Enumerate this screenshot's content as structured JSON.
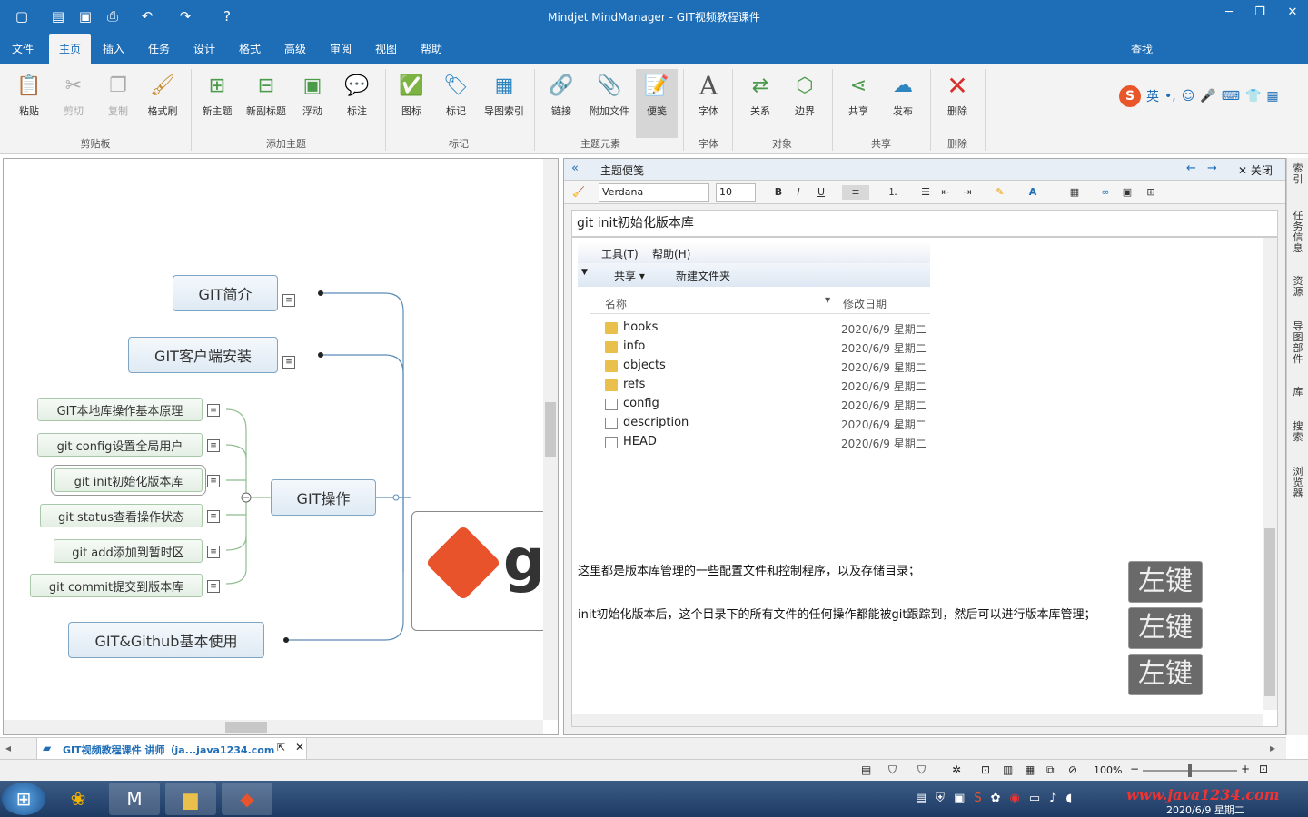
{
  "window": {
    "title": "Mindjet MindManager - GIT视频教程课件",
    "minimize": "─",
    "restore": "❐",
    "close": "✕"
  },
  "quick_access": [
    "new-icon",
    "open-icon",
    "save-icon",
    "print-icon",
    "undo-icon",
    "redo-icon",
    "help-icon"
  ],
  "menu": {
    "tabs": [
      "文件",
      "主页",
      "插入",
      "任务",
      "设计",
      "格式",
      "高级",
      "审阅",
      "视图",
      "帮助"
    ],
    "active": "主页",
    "find": "查找"
  },
  "ribbon": {
    "buttons": [
      {
        "label": "粘贴",
        "icon": "paste-icon",
        "disabled": false
      },
      {
        "label": "剪切",
        "icon": "scissors-icon",
        "disabled": true
      },
      {
        "label": "复制",
        "icon": "copy-icon",
        "disabled": true
      },
      {
        "label": "格式刷",
        "icon": "brush-icon",
        "disabled": false
      },
      {
        "label": "新主题",
        "icon": "new-topic-icon",
        "disabled": false
      },
      {
        "label": "新副标题",
        "icon": "new-subtopic-icon",
        "disabled": false
      },
      {
        "label": "浮动",
        "icon": "floating-icon",
        "disabled": false
      },
      {
        "label": "标注",
        "icon": "callout-icon",
        "disabled": false
      },
      {
        "label": "图标",
        "icon": "icon-marker-icon",
        "disabled": false
      },
      {
        "label": "标记",
        "icon": "tag-icon",
        "disabled": false
      },
      {
        "label": "导图索引",
        "icon": "map-index-icon",
        "disabled": false
      },
      {
        "label": "链接",
        "icon": "link-icon",
        "disabled": false
      },
      {
        "label": "附加文件",
        "icon": "attach-icon",
        "disabled": false
      },
      {
        "label": "便笺",
        "icon": "note-icon",
        "disabled": false
      },
      {
        "label": "字体",
        "icon": "font-icon",
        "disabled": false
      },
      {
        "label": "关系",
        "icon": "relationship-icon",
        "disabled": false
      },
      {
        "label": "边界",
        "icon": "boundary-icon",
        "disabled": false
      },
      {
        "label": "共享",
        "icon": "share-icon",
        "disabled": false
      },
      {
        "label": "发布",
        "icon": "publish-icon",
        "disabled": false
      },
      {
        "label": "删除",
        "icon": "delete-icon",
        "disabled": false
      }
    ],
    "groups": [
      "剪贴板",
      "添加主题",
      "标记",
      "主题元素",
      "字体",
      "对象",
      "共享",
      "删除"
    ],
    "ime": {
      "lang": "英"
    }
  },
  "mindmap": {
    "topics": [
      {
        "label": "GIT简介"
      },
      {
        "label": "GIT客户端安装"
      },
      {
        "label": "GIT操作"
      },
      {
        "label": "GIT&Github基本使用"
      }
    ],
    "subtopics": [
      {
        "label": "GIT本地库操作基本原理"
      },
      {
        "label": "git config设置全局用户"
      },
      {
        "label": "git init初始化版本库"
      },
      {
        "label": "git status查看操作状态"
      },
      {
        "label": "git add添加到暂时区"
      },
      {
        "label": "git commit提交到版本库"
      }
    ],
    "central_logo": "g"
  },
  "notes_pane": {
    "title": "主题便笺",
    "close": "关闭",
    "font": "Verdana",
    "size": "10",
    "topic": "git init初始化版本库",
    "explorer": {
      "menu": [
        "工具(T)",
        "帮助(H)"
      ],
      "tools": [
        "共享",
        "新建文件夹"
      ],
      "columns": [
        "名称",
        "修改日期"
      ],
      "files": [
        {
          "name": "hooks",
          "type": "folder",
          "date": "2020/6/9 星期二"
        },
        {
          "name": "info",
          "type": "folder",
          "date": "2020/6/9 星期二"
        },
        {
          "name": "objects",
          "type": "folder",
          "date": "2020/6/9 星期二"
        },
        {
          "name": "refs",
          "type": "folder",
          "date": "2020/6/9 星期二"
        },
        {
          "name": "config",
          "type": "file",
          "date": "2020/6/9 星期二"
        },
        {
          "name": "description",
          "type": "file",
          "date": "2020/6/9 星期二"
        },
        {
          "name": "HEAD",
          "type": "file",
          "date": "2020/6/9 星期二"
        }
      ]
    },
    "paragraphs": [
      "这里都是版本库管理的一些配置文件和控制程序，以及存储目录；",
      "init初始化版本后，这个目录下的所有文件的任何操作都能被git跟踪到，然后可以进行版本库管理；"
    ],
    "key_overlays": [
      "左键",
      "左键",
      "左键"
    ]
  },
  "sidebar": [
    "索引",
    "任务信息",
    "资源",
    "导图部件",
    "库",
    "搜索",
    "浏览器"
  ],
  "doc_tab": {
    "label": "GIT视频教程课件 讲师（ja...java1234.com"
  },
  "status": {
    "zoom": "100%"
  },
  "taskbar": {
    "watermark": "www.java1234.com",
    "date": "2020/6/9 星期二"
  }
}
